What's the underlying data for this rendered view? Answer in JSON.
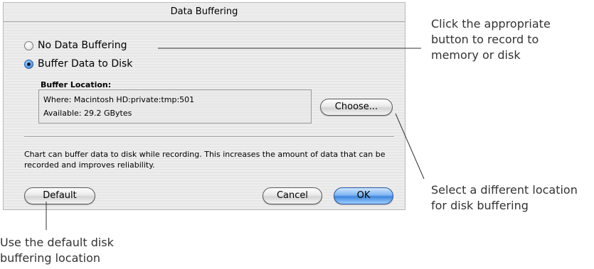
{
  "dialog": {
    "title": "Data Buffering",
    "options": [
      {
        "label": "No Data Buffering",
        "selected": false
      },
      {
        "label": "Buffer Data to Disk",
        "selected": true
      }
    ],
    "buffer_location": {
      "label": "Buffer Location:",
      "where": "Where: Macintosh HD:private:tmp:501",
      "available": "Available: 29.2 GBytes"
    },
    "choose_label": "Choose...",
    "info_text": "Chart can buffer data to disk while recording. This increases the amount of data that can be recorded and improves reliability.",
    "buttons": {
      "default_label": "Default",
      "cancel_label": "Cancel",
      "ok_label": "OK"
    }
  },
  "annotations": {
    "radio_note": [
      "Click the appropriate",
      "button to record to",
      "memory or disk"
    ],
    "choose_note": [
      "Select a different location",
      "for disk buffering"
    ],
    "default_note": [
      "Use the default disk",
      "buffering location"
    ]
  },
  "colors": {
    "default_button": "#3e86dc",
    "annotation_text": "#333333"
  }
}
